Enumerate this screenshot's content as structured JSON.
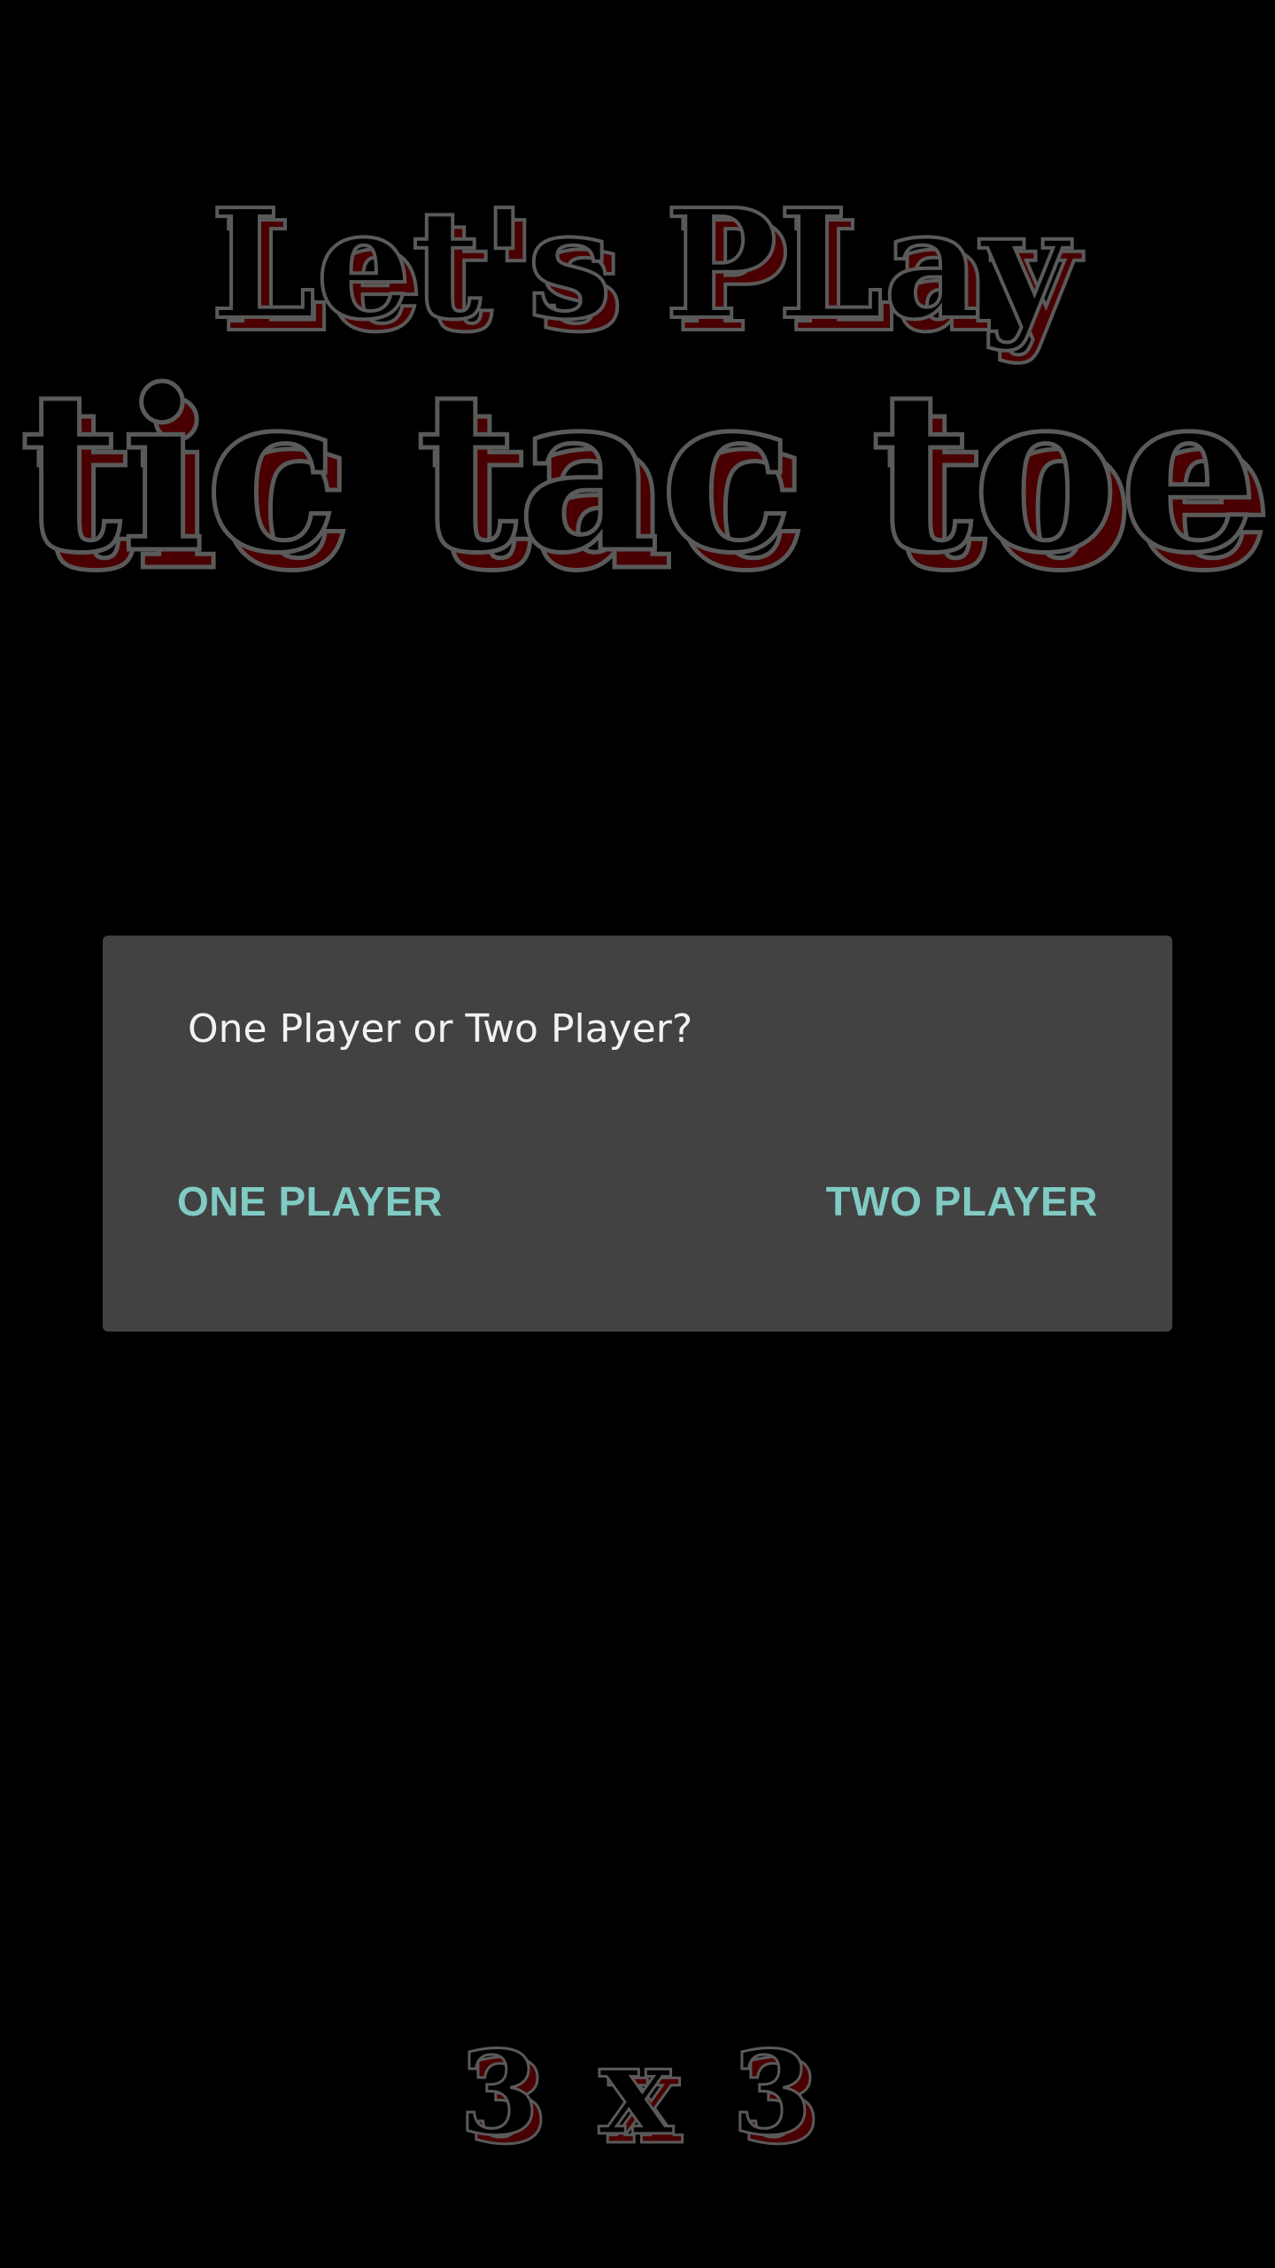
{
  "logo": {
    "line1": "Let's PLay",
    "line2": "tic tac toe",
    "grid_size_left": "3",
    "grid_size_sep": "x",
    "grid_size_right": "3"
  },
  "dialog": {
    "message": "One Player or Two Player?",
    "one_player_label": "ONE PLAYER",
    "two_player_label": "TWO PLAYER"
  },
  "colors": {
    "background": "#000000",
    "logo_fill": "#4a0000",
    "logo_outline": "#5a5a5a",
    "dialog_bg": "#424242",
    "accent": "#80cbc4"
  }
}
